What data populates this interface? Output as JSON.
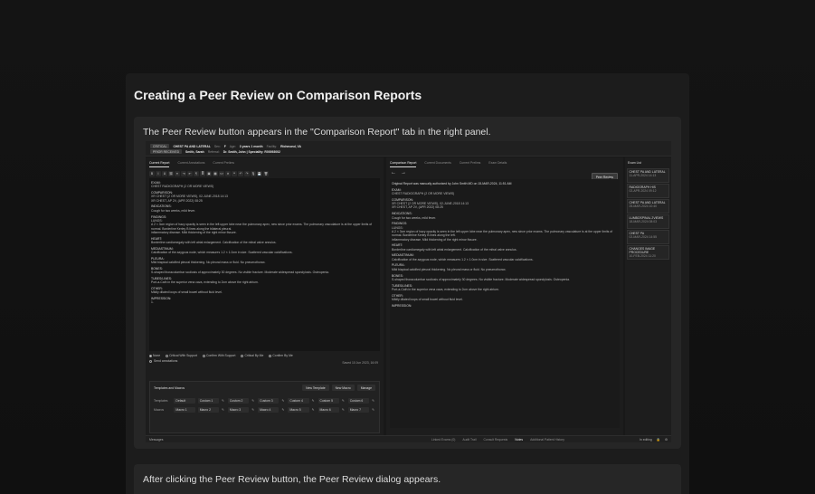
{
  "title": "Creating a Peer Review on Comparison Reports",
  "step1_text": "The Peer Review button appears in the \"Comparison Report\" tab in the right panel.",
  "step2_text": "After clicking the Peer Review button, the Peer Review dialog appears.",
  "shot": {
    "header": {
      "badge1": "CRITICAL",
      "study": "CHEST PA AND LATERAL",
      "sex_lbl": "Sex:",
      "sex": "F",
      "age_lbl": "Age:",
      "age": "3 years 1 month",
      "facility_lbl": "Facility:",
      "facility": "Richmond, VA",
      "badge2": "PRIOR RECEIVED",
      "patient": "Smith, Sarah",
      "referral_lbl": "Referral:",
      "referral": "Dr. Smith, John | Speciality: R00093002"
    },
    "left_tabs": [
      "Current Report",
      "Current Annotations",
      "Current Prelims"
    ],
    "toolbar_icons": [
      "bold-icon",
      "italic-icon",
      "underline-icon",
      "link-icon",
      "list-icon",
      "indent-icon",
      "outdent-icon",
      "format-icon",
      "align-icon",
      "image-icon",
      "table-icon",
      "code-icon",
      "clear-icon",
      "quote-icon",
      "undo-icon",
      "redo-icon",
      "mic-icon",
      "save-icon",
      "trash-icon"
    ],
    "toolbar_glyphs": [
      "B",
      "I",
      "U",
      "⛓",
      "≡",
      "⇥",
      "⇤",
      "¶",
      "≣",
      "▣",
      "▦",
      "<>",
      "✕",
      "❝",
      "↶",
      "↷",
      "🎙",
      "💾",
      "🗑"
    ],
    "left_report": [
      {
        "h": "EXAM:",
        "b": "CHEST RADIOGRAPH (2 OR MORE VIEWS)"
      },
      {
        "h": "COMPARISON:",
        "b": "XR CHEST (2 OR MORE VIEWS), 02-JUNE-2018 14:13\nXR CHEST, AP 2V, (APR 2022) 08:25"
      },
      {
        "h": "INDICATIONS:",
        "b": "Cough for two weeks, mild fever."
      },
      {
        "h": "FINDINGS:",
        "b": "LUNGS:\nA 2 × 3cm region of hazy opacity is seen in the left upper lobe near the pulmonary apex, new since prior exams. The pulmonary vasculature is at the upper limits of normal. Borderline Kerley B lines along the bilateral pleural.\ninflammatory disease. Mild thickening of the right minor fissure."
      },
      {
        "h": "HEART:",
        "b": "Borderline cardiomegaly with left atrial enlargement. Calcification of the mitral valve annulus."
      },
      {
        "h": "MEDIASTINUM:",
        "b": "Calcification of the azygous node, which measures 1.2 × 1.0cm in size. Scattered vascular calcifications."
      },
      {
        "h": "PLEURA:",
        "b": "Mild biapical calcified pleural thickening. No pleural mass or fluid. No pneumothorax."
      },
      {
        "h": "BONES:",
        "b": "S-shaped thoracolumbar scoliosis of approximately 30 degrees. No visible fracture. Moderate widespread spondylosis. Osteopenia."
      },
      {
        "h": "TUBES/LINES:",
        "b": "Port-a-Cath in the superior vena cava, extending to 2cm above the right atrium."
      },
      {
        "h": "OTHER:",
        "b": "Mildly dilated loops of small bowel without fluid level."
      },
      {
        "h": "IMPRESSION:",
        "b": "1."
      }
    ],
    "radio_options": [
      "None",
      "Critical With Support",
      "Confirm With Support",
      "Critical By Me",
      "Confirm By Me"
    ],
    "send_label": "Send annotations",
    "saved_label": "Saved 10 Jun 2023, 16:09",
    "tm_title": "Templates and Macros",
    "tm_buttons": [
      "New Template",
      "New Macro",
      "Manage"
    ],
    "templates_label": "Templates",
    "templates": [
      "Default",
      "Custom 1",
      "Custom 2",
      "Custom 3",
      "Custom 4",
      "Custom 5",
      "Custom 6"
    ],
    "macros_label": "Macros",
    "macros": [
      "Macro 1",
      "Macro 2",
      "Macro 3",
      "Macro 4",
      "Macro 5",
      "Macro 6",
      "Macro 7"
    ],
    "mid_tabs": [
      "Comparison Report",
      "Current Documents",
      "Current Prelims",
      "Exam Details"
    ],
    "peer_review_label": "Peer Review",
    "original_report": "Original Report was manually authorized by John Smith MD on 15-MAR-2024, 11:51 AM",
    "mid_report": [
      {
        "h": "EXAM:",
        "b": "CHEST RADIOGRAPH (2 OR MORE VIEWS)"
      },
      {
        "h": "COMPARISON:",
        "b": "XR CHEST (2 OR MORE VIEWS), 02-JUNE-2018 14:13\nXR CHEST, AP 2V, (APR 2022) 08:25"
      },
      {
        "h": "INDICATIONS:",
        "b": "Cough for two weeks, mild fever."
      },
      {
        "h": "FINDINGS:",
        "b": "LUNGS:\nA 2 × 3cm region of hazy opacity is seen in the left upper lobe near the pulmonary apex, new since prior exams. The pulmonary vasculature is at the upper limits of normal. Borderline Kerley B lines along the left.\ninflammatory disease. Mild thickening of the right minor fissure."
      },
      {
        "h": "HEART:",
        "b": "Borderline cardiomegaly with left atrial enlargement. Calcification of the mitral valve annulus."
      },
      {
        "h": "MEDIASTINUM:",
        "b": "Calcification of the azygous node, which measures 1.2 × 1.0cm in size. Scattered vascular calcifications."
      },
      {
        "h": "PLEURA:",
        "b": "Mild biapical calcified pleural thickening. No pleural mass or fluid. No pneumothorax."
      },
      {
        "h": "BONES:",
        "b": "S-shaped thoracolumbar scoliosis of approximately 30 degrees. No visible fracture. Moderate widespread spondylosis. Osteopenia."
      },
      {
        "h": "TUBES/LINES:",
        "b": "Port-a-Cath in the superior vena cava, extending to 2cm above the right atrium."
      },
      {
        "h": "OTHER:",
        "b": "Mildly dilated loops of small bowel without fluid level."
      },
      {
        "h": "IMPRESSION:",
        "b": ""
      }
    ],
    "exam_list_title": "Exam List",
    "exams": [
      {
        "name": "CHEST PA AND LATERAL",
        "date": "11-APR-2024 14:13"
      },
      {
        "name": "RADIOGRAPH HIS",
        "date": "02-APR-2024 09:12"
      },
      {
        "name": "CHEST PA AND LATERAL",
        "date": "25-MAR-2024 10:40"
      },
      {
        "name": "LUMBOSPINAL 2VIEWS",
        "date": "18-MAR-2024 08:03"
      },
      {
        "name": "CHEST PA",
        "date": "02-MAR-2024 14:55"
      },
      {
        "name": "CHANGES IMAGE PROCEDURE",
        "date": "10-FEB-2024 11:20"
      }
    ],
    "status": {
      "messages": "Messages",
      "tabs": [
        "Linked Exams (0)",
        "Audit Trail",
        "Consult Requests",
        "Notes",
        "Additional Patient History"
      ],
      "active_tab": "Notes",
      "right": "In editing"
    }
  }
}
